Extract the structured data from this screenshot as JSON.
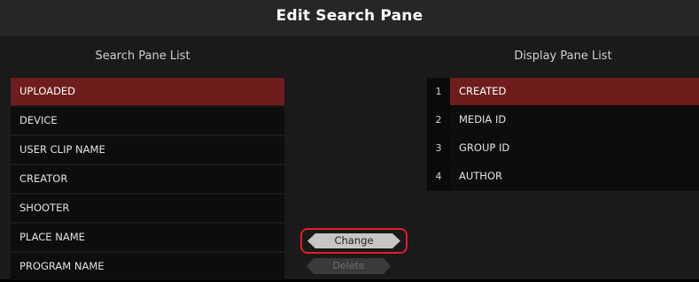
{
  "window": {
    "title": "Edit Search Pane"
  },
  "search_pane": {
    "header": "Search Pane List",
    "items": [
      {
        "label": "UPLOADED"
      },
      {
        "label": "DEVICE"
      },
      {
        "label": "USER CLIP NAME"
      },
      {
        "label": "CREATOR"
      },
      {
        "label": "SHOOTER"
      },
      {
        "label": "PLACE NAME"
      },
      {
        "label": "PROGRAM NAME"
      }
    ],
    "selected": "UPLOADED"
  },
  "display_pane": {
    "header": "Display Pane List",
    "items": [
      {
        "index": "1",
        "label": "CREATED"
      },
      {
        "index": "2",
        "label": "MEDIA ID"
      },
      {
        "index": "3",
        "label": "GROUP ID"
      },
      {
        "index": "4",
        "label": "AUTHOR"
      }
    ],
    "selected": "CREATED"
  },
  "actions": {
    "change_label": "Change",
    "delete_label": "Delete"
  },
  "colors": {
    "selection": "#6e1c1c",
    "highlight_outline": "#e21b2b"
  }
}
